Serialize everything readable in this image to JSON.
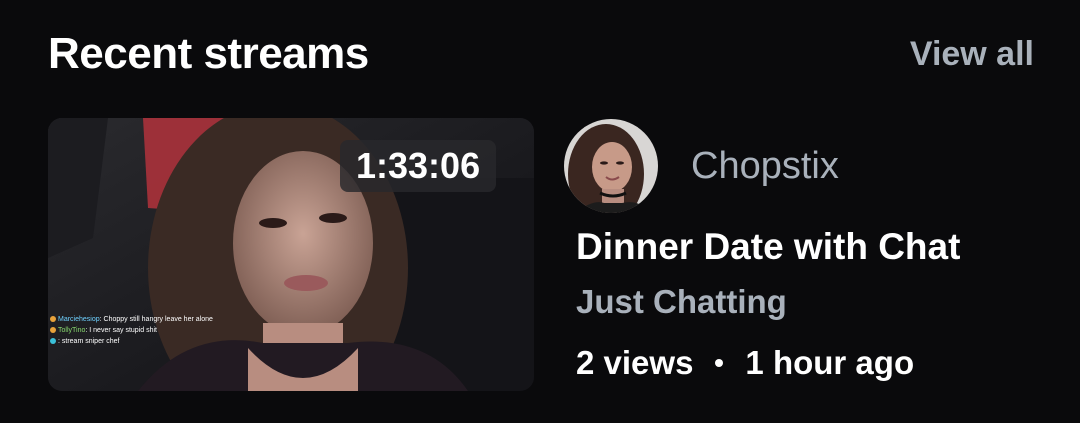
{
  "section": {
    "title": "Recent streams",
    "view_all_label": "View all"
  },
  "stream": {
    "duration": "1:33:06",
    "channel_name": "Chopstix",
    "title": "Dinner Date with Chat",
    "category": "Just Chatting",
    "views": "2 views",
    "age": "1 hour ago",
    "chat_overlay": [
      {
        "user": "Marciehesiop",
        "message": ": Choppy still hangry leave her alone"
      },
      {
        "user": "TollyTino",
        "message": ": I never say stupid shit"
      },
      {
        "user": "",
        "message": ": stream sniper chef"
      }
    ]
  },
  "icons": {
    "separator": "bullet-dot-icon",
    "avatar": "channel-avatar"
  }
}
